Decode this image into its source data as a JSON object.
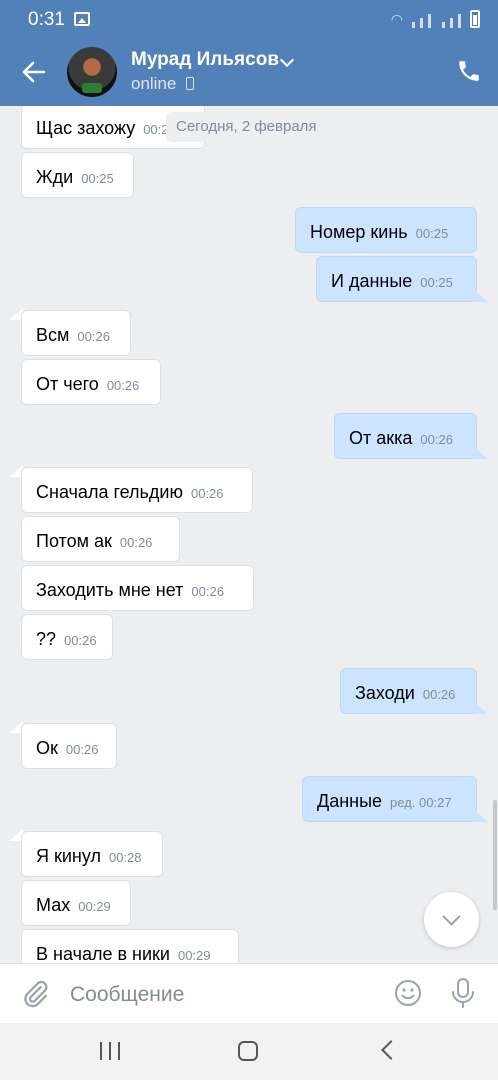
{
  "status": {
    "time": "0:31"
  },
  "header": {
    "contact_name": "Мурад Ильясов",
    "presence": "online"
  },
  "date_separator": "Сегодня, 2 февраля",
  "messages": [
    {
      "dir": "in",
      "text": "Щас захожу",
      "time": "00:25"
    },
    {
      "dir": "in",
      "text": "Жди",
      "time": "00:25"
    },
    {
      "dir": "out",
      "text": "Номер кинь",
      "time": "00:25"
    },
    {
      "dir": "out",
      "text": "И данные",
      "time": "00:25"
    },
    {
      "dir": "in",
      "text": "Всм",
      "time": "00:26"
    },
    {
      "dir": "in",
      "text": "От чего",
      "time": "00:26"
    },
    {
      "dir": "out",
      "text": "От акка",
      "time": "00:26"
    },
    {
      "dir": "in",
      "text": "Сначала гельдию",
      "time": "00:26"
    },
    {
      "dir": "in",
      "text": "Потом ак",
      "time": "00:26"
    },
    {
      "dir": "in",
      "text": "Заходить мне нет",
      "time": "00:26"
    },
    {
      "dir": "in",
      "text": "??",
      "time": "00:26"
    },
    {
      "dir": "out",
      "text": "Заходи",
      "time": "00:26"
    },
    {
      "dir": "in",
      "text": "Ок",
      "time": "00:26"
    },
    {
      "dir": "out",
      "text": "Данные",
      "time": "ред. 00:27"
    },
    {
      "dir": "in",
      "text": "Я кинул",
      "time": "00:28"
    },
    {
      "dir": "in",
      "text": "Мах",
      "time": "00:29"
    },
    {
      "dir": "in",
      "text": "В начале в ники",
      "time": "00:29"
    }
  ],
  "composer": {
    "placeholder": "Сообщение"
  },
  "colors": {
    "header": "#5181b8",
    "incoming": "#ffffff",
    "outgoing": "#cce4ff",
    "background": "#edeef0"
  }
}
